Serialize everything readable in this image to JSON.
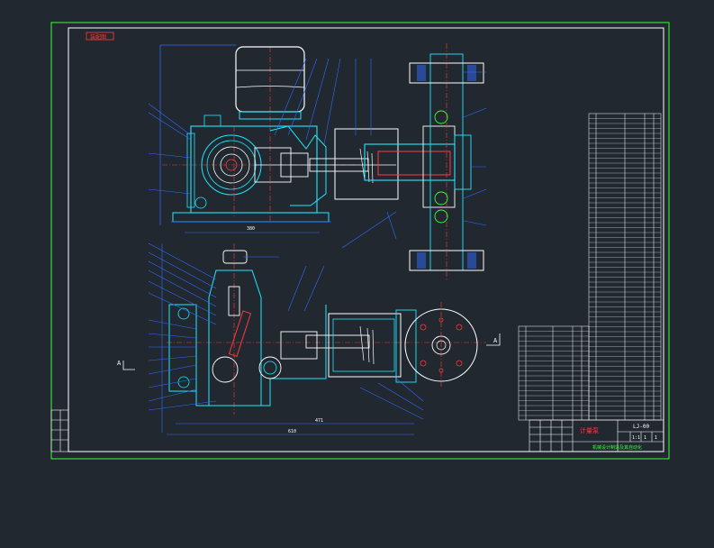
{
  "drawing": {
    "title_tag": "装配图",
    "title_block_name": "计量泵",
    "title_block_drawing_no": "LJ-00",
    "title_block_scale": "1:1",
    "title_block_sheet": "1",
    "title_block_total": "1",
    "company_line": "机械设计制造及其自动化",
    "dimension_labels": {
      "upper_width": "380",
      "lower_width_a": "471",
      "lower_width_b": "610"
    },
    "section_marks": {
      "A1": "A",
      "A2": "A",
      "AA": "A-A"
    }
  },
  "colors": {
    "background": "#212830",
    "frame": "#39ff39",
    "outline": "#2f6cff",
    "white": "#ffffff",
    "cyan": "#1fe8ff",
    "red": "#ff3a3a",
    "yellow": "#ffe033",
    "magenta": "#ff45ff"
  }
}
